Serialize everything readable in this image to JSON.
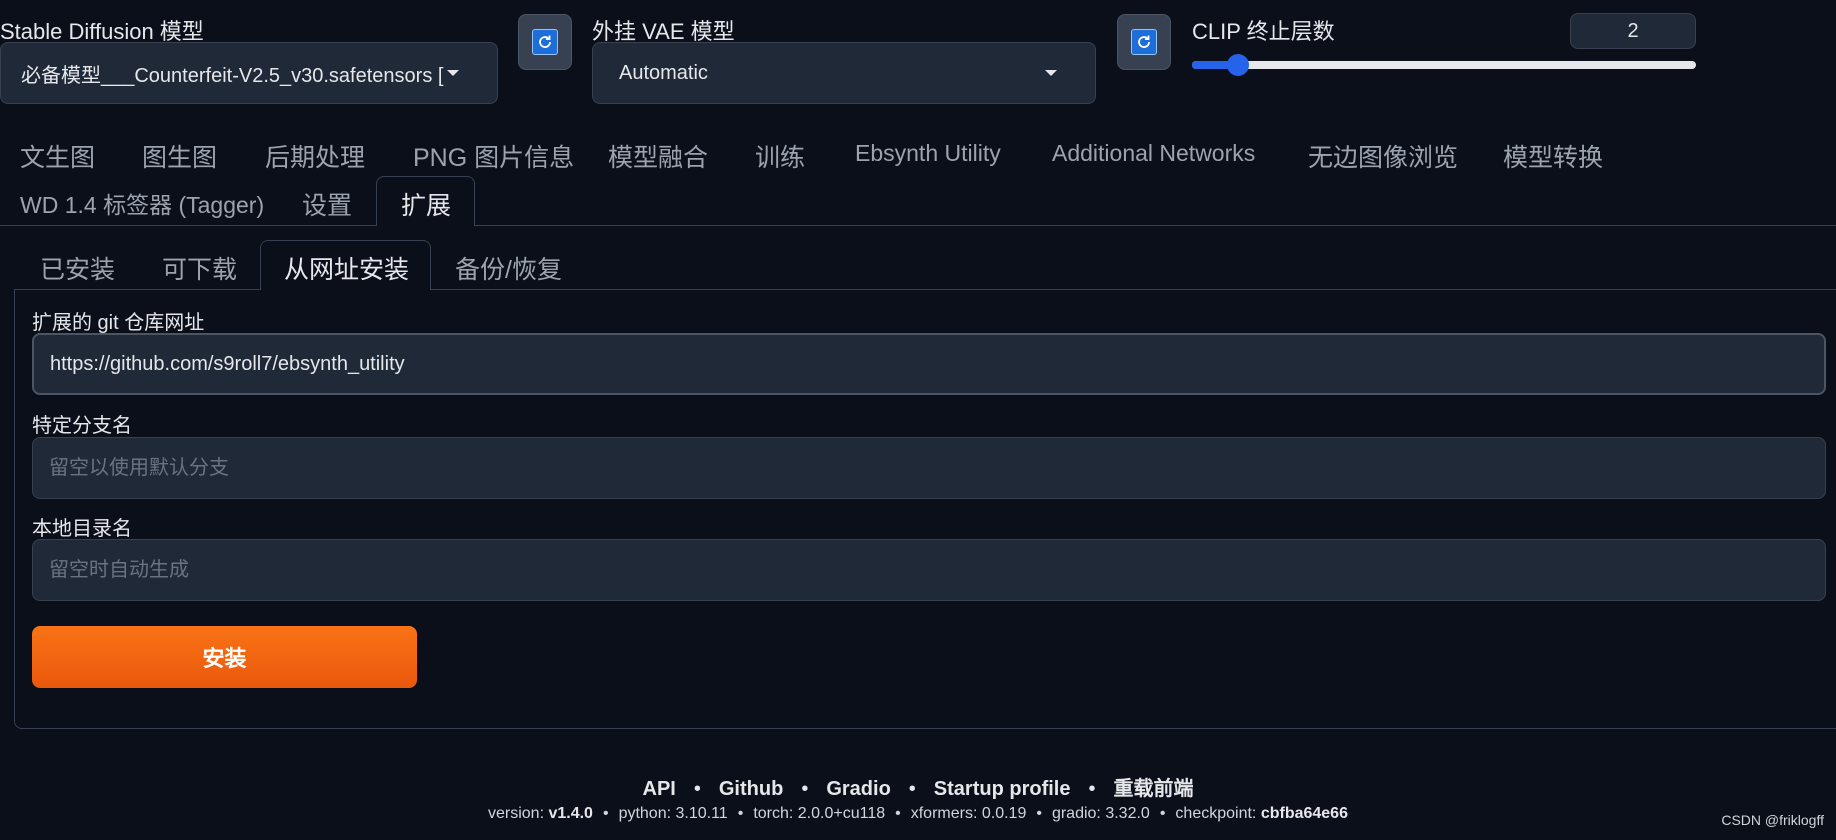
{
  "top": {
    "sd_model": {
      "label": "Stable Diffusion 模型",
      "value": "必备模型___Counterfeit-V2.5_v30.safetensors ["
    },
    "vae": {
      "label": "外挂 VAE 模型",
      "value": "Automatic"
    },
    "clip": {
      "label": "CLIP 终止层数",
      "value": "2",
      "fraction": 0.07
    }
  },
  "main_tabs": [
    "文生图",
    "图生图",
    "后期处理",
    "PNG 图片信息",
    "模型融合",
    "训练",
    "Ebsynth Utility",
    "Additional Networks",
    "无边图像浏览",
    "模型转换",
    "WD 1.4 标签器 (Tagger)",
    "设置",
    "扩展"
  ],
  "sub_tabs": [
    "已安装",
    "可下载",
    "从网址安装",
    "备份/恢复"
  ],
  "form": {
    "url_label": "扩展的 git 仓库网址",
    "url_value": "https://github.com/s9roll7/ebsynth_utility",
    "branch_label": "特定分支名",
    "branch_placeholder": "留空以使用默认分支",
    "dir_label": "本地目录名",
    "dir_placeholder": "留空时自动生成",
    "install_button": "安装"
  },
  "footer": {
    "links": [
      "API",
      "Github",
      "Gradio",
      "Startup profile",
      "重载前端"
    ],
    "versions": [
      {
        "key": "version: ",
        "value": "v1.4.0",
        "bold": true
      },
      {
        "key": "python: ",
        "value": "3.10.11",
        "bold": false
      },
      {
        "key": "torch: ",
        "value": "2.0.0+cu118",
        "bold": false
      },
      {
        "key": "xformers: ",
        "value": "0.0.19",
        "bold": false
      },
      {
        "key": "gradio: ",
        "value": "3.32.0",
        "bold": false
      },
      {
        "key": "checkpoint: ",
        "value": "cbfba64e66",
        "bold": true
      }
    ]
  },
  "watermark": "CSDN @friklogff",
  "colors": {
    "bg": "#0b0f19",
    "panel": "#1f2937",
    "accent": "#f97316",
    "slider": "#2563eb"
  }
}
